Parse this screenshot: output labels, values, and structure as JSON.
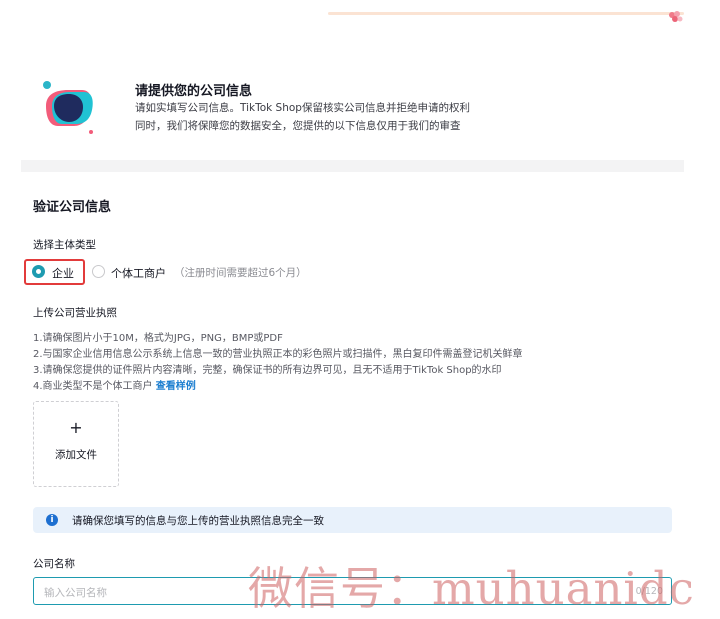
{
  "header": {
    "title": "请提供您的公司信息",
    "line1": "请如实填写公司信息。TikTok Shop保留核实公司信息并拒绝申请的权利",
    "line2": "同时，我们将保障您的数据安全，您提供的以下信息仅用于我们的审查"
  },
  "section": {
    "title": "验证公司信息"
  },
  "entity_type": {
    "label": "选择主体类型",
    "options": [
      {
        "label": "企业",
        "checked": true
      },
      {
        "label": "个体工商户",
        "checked": false
      }
    ],
    "hint": "（注册时间需要超过6个月）"
  },
  "license": {
    "label": "上传公司营业执照",
    "requirements": [
      "1.请确保图片小于10M，格式为JPG，PNG，BMP或PDF",
      "2.与国家企业信用信息公示系统上信息一致的营业执照正本的彩色照片或扫描件，黑白复印件需盖登记机关鲜章",
      "3.请确保您提供的证件照片内容清晰，完整，确保证书的所有边界可见，且无不适用于TikTok Shop的水印",
      "4.商业类型不是个体工商户"
    ],
    "sample_link": "查看样例",
    "upload_plus": "+",
    "upload_label": "添加文件"
  },
  "notice": {
    "icon": "info-icon",
    "icon_glyph": "i",
    "text": "请确保您填写的信息与您上传的营业执照信息完全一致"
  },
  "company_name": {
    "label": "公司名称",
    "placeholder": "输入公司名称",
    "counter": "0/120"
  },
  "watermark": {
    "text": "微信号：muhuanidc"
  },
  "colors": {
    "accent": "#1e9bb0",
    "highlight": "#e23b3b",
    "link": "#1d7fd0",
    "notice_bg": "#e8f1fb"
  }
}
